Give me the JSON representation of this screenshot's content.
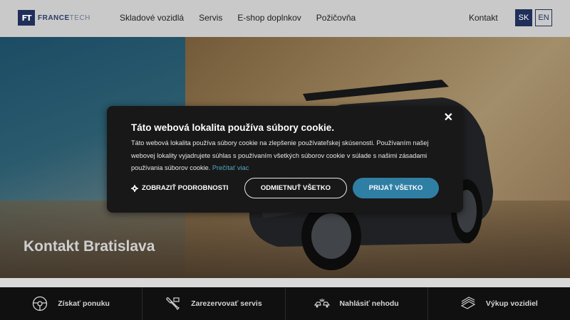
{
  "header": {
    "logo_main": "FRANCE",
    "logo_sub": "TECH",
    "logo_mark": "FT",
    "nav": [
      "Skladové vozidlá",
      "Servis",
      "E-shop doplnkov",
      "Požičovňa"
    ],
    "contact": "Kontakt",
    "lang_sk": "SK",
    "lang_en": "EN"
  },
  "hero": {
    "title": "Kontakt Bratislava"
  },
  "cookie": {
    "title": "Táto webová lokalita používa súbory cookie.",
    "text": "Táto webová lokalita používa súbory cookie na zlepšenie používateľskej skúsenosti. Používaním našej webovej lokality vyjadrujete súhlas s používaním všetkých súborov cookie v súlade s našimi zásadami používania súborov cookie.",
    "link": "Prečítať viac",
    "details": "ZOBRAZIŤ PODROBNOSTI",
    "reject": "ODMIETNUŤ VŠETKO",
    "accept": "PRIJAŤ VŠETKO",
    "close": "✕",
    "accent": "#2f7fa4"
  },
  "bottom": {
    "items": [
      {
        "label": "Získať ponuku",
        "icon": "steering-wheel-icon"
      },
      {
        "label": "Zarezervovať servis",
        "icon": "wrench-icon"
      },
      {
        "label": "Nahlásiť nehodu",
        "icon": "crash-icon"
      },
      {
        "label": "Výkup vozidiel",
        "icon": "money-icon"
      }
    ]
  }
}
